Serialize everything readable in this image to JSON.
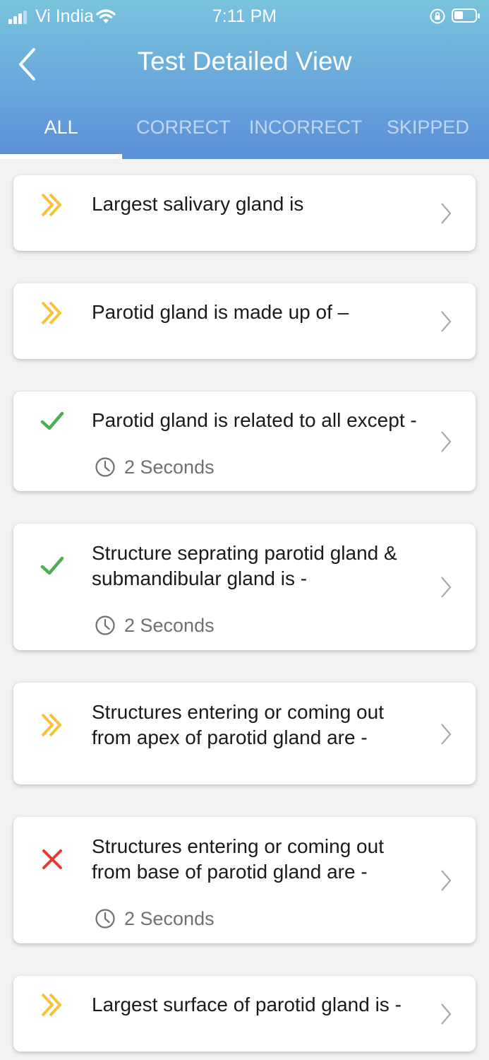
{
  "status_bar": {
    "carrier": "Vi India",
    "time": "7:11 PM"
  },
  "header": {
    "title": "Test Detailed View"
  },
  "tabs": [
    {
      "label": "ALL",
      "active": true
    },
    {
      "label": "CORRECT",
      "active": false
    },
    {
      "label": "INCORRECT",
      "active": false
    },
    {
      "label": "SKIPPED",
      "active": false
    }
  ],
  "colors": {
    "skipped": "#f5c23c",
    "correct": "#4caf50",
    "incorrect": "#e53935",
    "header_top": "#78c3dc",
    "header_bottom": "#5b8fd8"
  },
  "questions": [
    {
      "text": "Largest salivary gland is",
      "status": "skipped",
      "status_icon": "double-chevron-right-icon"
    },
    {
      "text": "Parotid gland is made up of –",
      "status": "skipped",
      "status_icon": "double-chevron-right-icon"
    },
    {
      "text": "Parotid gland is related to all except -",
      "status": "correct",
      "status_icon": "checkmark-icon",
      "duration": "2 Seconds"
    },
    {
      "text": "Structure seprating parotid gland & submandibular gland is -",
      "status": "correct",
      "status_icon": "checkmark-icon",
      "duration": "2 Seconds"
    },
    {
      "text": "Structures entering or coming out from apex of parotid gland are -",
      "status": "skipped",
      "status_icon": "double-chevron-right-icon"
    },
    {
      "text": "Structures entering or coming out from base of parotid gland are -",
      "status": "incorrect",
      "status_icon": "cross-icon",
      "duration": "2 Seconds"
    },
    {
      "text": "Largest surface of parotid gland is -",
      "status": "skipped",
      "status_icon": "double-chevron-right-icon"
    }
  ]
}
